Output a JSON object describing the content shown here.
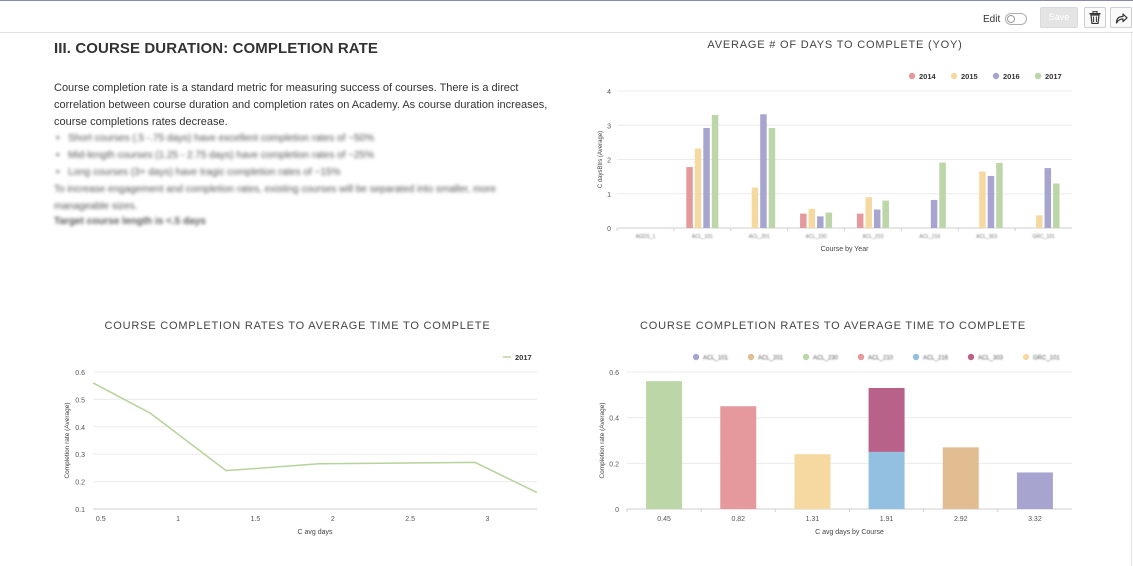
{
  "toolbar": {
    "edit_label": "Edit",
    "save_label": "Save"
  },
  "section": {
    "title": "III. COURSE DURATION: COMPLETION RATE",
    "paragraph": "Course completion rate is a standard metric for measuring success of courses. There is a direct correlation between course duration and completion rates on Academy. As course duration increases, course completions rates decrease.",
    "bullets": [
      "Short courses (.5 -.75 days) have excellent completion rates of ~50%",
      "Mid-length courses (1.25 - 2.75 days) have completion rates of ~25%",
      "Long courses (3+ days) have tragic completion rates of ~15%"
    ],
    "followup": "To increase engagement and completion rates, existing courses will be separated into smaller, more manageable sizes.",
    "target": "Target course length is <.5 days"
  },
  "charts": {
    "yoy_title": "AVERAGE # OF DAYS TO COMPLETE (YOY)",
    "line_title": "COURSE COMPLETION RATES TO AVERAGE TIME TO COMPLETE",
    "bar_title": "COURSE COMPLETION RATES TO AVERAGE TIME TO COMPLETE"
  },
  "chart_data": [
    {
      "type": "bar",
      "title": "AVERAGE # OF DAYS TO COMPLETE (YOY)",
      "xlabel": "Course by Year",
      "ylabel": "C daysBtrs (Average)",
      "ylim": [
        0,
        4
      ],
      "yticks": [
        "0",
        "1",
        "2",
        "3",
        "4"
      ],
      "categories": [
        "AGDS_1",
        "ACL_101",
        "ACL_201",
        "ACL_230",
        "ACL_210",
        "ACL_216",
        "ACL_303",
        "GRC_101"
      ],
      "series": [
        {
          "name": "2014",
          "color": "#e5999d",
          "values": [
            0,
            1.78,
            0,
            0.42,
            0.42,
            0,
            0,
            0
          ]
        },
        {
          "name": "2015",
          "color": "#f5d9a0",
          "values": [
            0,
            2.32,
            1.18,
            0.56,
            0.9,
            0,
            1.65,
            0.37
          ]
        },
        {
          "name": "2016",
          "color": "#a7a4d0",
          "values": [
            0,
            2.92,
            3.32,
            0.34,
            0.54,
            0.82,
            1.52,
            1.75
          ]
        },
        {
          "name": "2017",
          "color": "#bcd6a8",
          "values": [
            0,
            3.3,
            2.92,
            0.45,
            0.8,
            1.91,
            1.9,
            1.3
          ]
        }
      ],
      "legend_position": "top-right",
      "grid": true
    },
    {
      "type": "line",
      "title": "COURSE COMPLETION RATES TO AVERAGE TIME TO COMPLETE",
      "xlabel": "C avg days",
      "ylabel": "Completion rate (Average)",
      "xlim": [
        0.45,
        3.32
      ],
      "ylim": [
        0.1,
        0.6
      ],
      "xticks": [
        "0.5",
        "1",
        "1.5",
        "2",
        "2.5",
        "3"
      ],
      "yticks": [
        "0.1",
        "0.2",
        "0.3",
        "0.4",
        "0.5",
        "0.6"
      ],
      "series": [
        {
          "name": "2017",
          "color": "#b5d39a",
          "x": [
            0.45,
            0.82,
            1.31,
            1.91,
            2.92,
            3.32
          ],
          "y": [
            0.56,
            0.45,
            0.24,
            0.265,
            0.27,
            0.16
          ]
        }
      ],
      "legend_position": "top-right",
      "grid": true
    },
    {
      "type": "bar",
      "stacked": true,
      "title": "COURSE COMPLETION RATES TO AVERAGE TIME TO COMPLETE",
      "xlabel": "C avg days by Course",
      "ylabel": "Completion rate (Average)",
      "ylim": [
        0,
        0.6
      ],
      "yticks": [
        "0",
        "0.2",
        "0.4",
        "0.6"
      ],
      "categories": [
        "0.45",
        "0.82",
        "1.31",
        "1.91",
        "2.92",
        "3.32"
      ],
      "series": [
        {
          "name": "ACL_101",
          "color": "#a7a4d0",
          "values": [
            0,
            0,
            0,
            0,
            0,
            0.16
          ]
        },
        {
          "name": "ACL_201",
          "color": "#e2bd92",
          "values": [
            0,
            0,
            0,
            0,
            0.27,
            0
          ]
        },
        {
          "name": "ACL_230",
          "color": "#bcd6a8",
          "values": [
            0.56,
            0,
            0,
            0,
            0,
            0
          ]
        },
        {
          "name": "ACL_210",
          "color": "#e5999d",
          "values": [
            0,
            0.45,
            0,
            0,
            0,
            0
          ]
        },
        {
          "name": "ACL_216",
          "color": "#93bfe0",
          "values": [
            0,
            0,
            0,
            0.25,
            0,
            0
          ]
        },
        {
          "name": "ACL_303",
          "color": "#b8628a",
          "values": [
            0,
            0,
            0,
            0.28,
            0,
            0
          ]
        },
        {
          "name": "GRC_101",
          "color": "#f5d9a0",
          "values": [
            0,
            0,
            0.24,
            0,
            0,
            0
          ]
        }
      ],
      "legend_position": "top",
      "grid": true
    }
  ]
}
